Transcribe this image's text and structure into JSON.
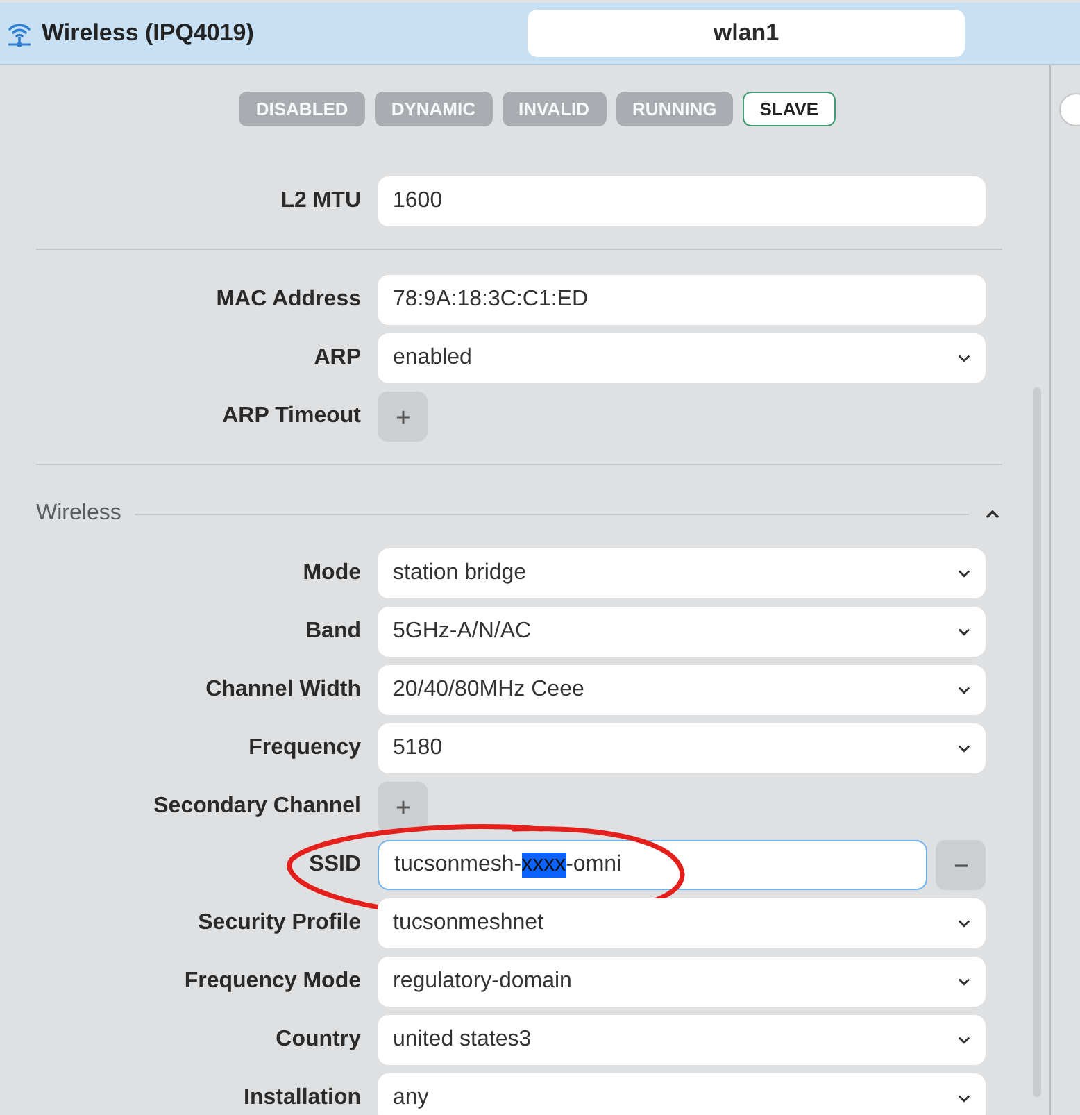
{
  "header": {
    "title": "Wireless (IPQ4019)",
    "name": "wlan1"
  },
  "flags": [
    {
      "label": "DISABLED",
      "active": false
    },
    {
      "label": "DYNAMIC",
      "active": false
    },
    {
      "label": "INVALID",
      "active": false
    },
    {
      "label": "RUNNING",
      "active": false
    },
    {
      "label": "SLAVE",
      "active": true
    }
  ],
  "sections": [
    {
      "rows": [
        {
          "kind": "input",
          "label": "L2 MTU",
          "value": "1600"
        }
      ]
    },
    {
      "rows": [
        {
          "kind": "input",
          "label": "MAC Address",
          "value": "78:9A:18:3C:C1:ED"
        },
        {
          "kind": "select",
          "label": "ARP",
          "value": "enabled"
        },
        {
          "kind": "add",
          "label": "ARP Timeout"
        }
      ]
    },
    {
      "title": "Wireless",
      "expanded": true,
      "rows": [
        {
          "kind": "select",
          "label": "Mode",
          "value": "station bridge"
        },
        {
          "kind": "select",
          "label": "Band",
          "value": "5GHz-A/N/AC"
        },
        {
          "kind": "select",
          "label": "Channel Width",
          "value": "20/40/80MHz Ceee"
        },
        {
          "kind": "select",
          "label": "Frequency",
          "value": "5180"
        },
        {
          "kind": "add",
          "label": "Secondary Channel"
        },
        {
          "kind": "removable",
          "label": "SSID",
          "focused": true,
          "annotated": true,
          "value_parts": [
            {
              "text": "tucsonmesh-",
              "selected": false
            },
            {
              "text": "xxxx",
              "selected": true
            },
            {
              "text": "-omni",
              "selected": false
            }
          ]
        },
        {
          "kind": "select",
          "label": "Security Profile",
          "value": "tucsonmeshnet"
        },
        {
          "kind": "select",
          "label": "Frequency Mode",
          "value": "regulatory-domain"
        },
        {
          "kind": "select",
          "label": "Country",
          "value": "united states3"
        },
        {
          "kind": "select",
          "label": "Installation",
          "value": "any"
        }
      ]
    }
  ]
}
